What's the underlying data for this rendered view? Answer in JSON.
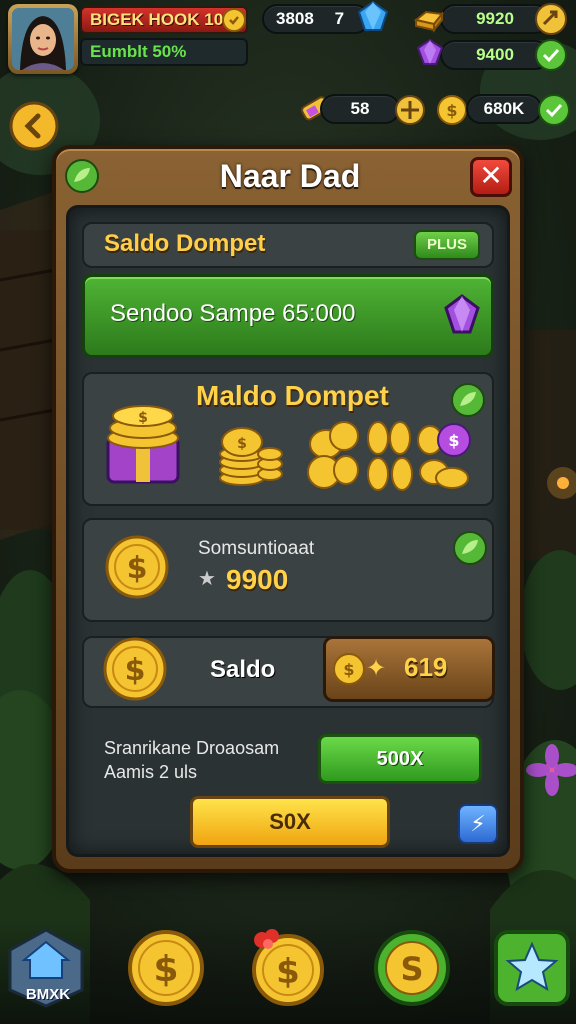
{
  "hud": {
    "player_name": "BIGEK HOOK 100",
    "player_sub": "Eumblt 50%",
    "stat_1_value": "3808",
    "stat_1_count": "7",
    "gold_value": "9920",
    "gem_value": "9400",
    "energy_value": "58",
    "coin_value": "680K"
  },
  "panel": {
    "title": "Naar Dad",
    "close_label": "✕",
    "wallet_title": "Saldo Dompet",
    "plus_label": "PLUS",
    "balance_text": "Sendoo Sampe 65:000",
    "bundle_title": "Maldo Dompet",
    "earning_label": "Somsuntioaat",
    "earning_value": "9900",
    "saldo_label": "Saldo",
    "saldo_value": "619",
    "info_line_1": "Sranrikane Droaosam",
    "info_line_2": "Aamis 2 uls",
    "green_button_label": "500X",
    "yellow_button_label": "S0X"
  },
  "nav": {
    "home_label": "BMXK"
  },
  "colors": {
    "panel_wood": "#7a5427",
    "accent_gold": "#ffcf4a",
    "accent_green": "#4fb434",
    "close_red": "#d3352a"
  }
}
